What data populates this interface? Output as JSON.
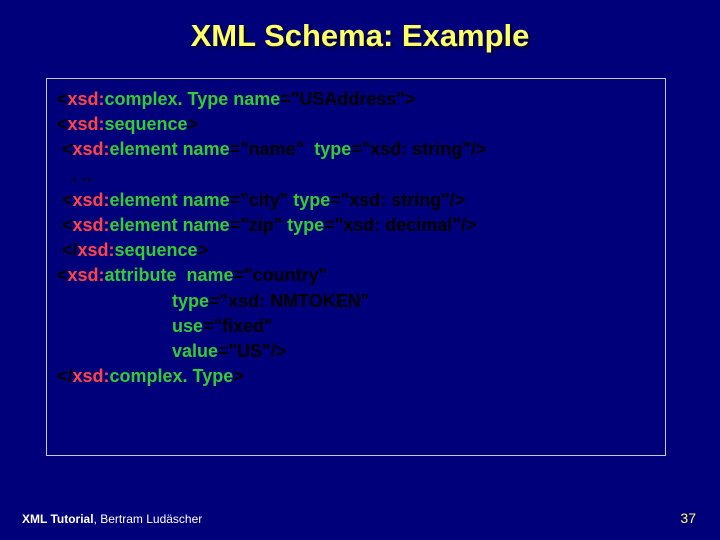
{
  "title": "XML Schema: Example",
  "footer": {
    "tutorial": "XML Tutorial",
    "author": ", Bertram Ludäscher",
    "page": "37"
  },
  "code": {
    "l1": {
      "open": "<",
      "ns": "xsd:",
      "kw": "complex. Type",
      "nameLbl": " name",
      "tail": "=\"USAddress\">"
    },
    "l2": {
      "open": "<",
      "ns": "xsd:",
      "kw": "sequence",
      "tail": ">"
    },
    "l3": {
      "ind": " ",
      "open": " <",
      "ns": "xsd:",
      "kw": "element",
      "nameLbl": " name",
      "eq1": "=\"name\"  ",
      "typeLbl": "type",
      "tail": "=\"xsd: string\"/>"
    },
    "l4": {
      "txt": "   . .."
    },
    "l5": {
      "ind": " ",
      "open": " <",
      "ns": "xsd:",
      "kw": "element",
      "nameLbl": " name",
      "eq1": "=\"city\" ",
      "typeLbl": "type",
      "tail": "=\"xsd: string\"/>"
    },
    "l6": {
      "ind": " ",
      "open": " <",
      "ns": "xsd:",
      "kw": "element",
      "nameLbl": " name",
      "eq1": "=\"zip\" ",
      "typeLbl": "type",
      "tail": "=\"xsd: decimal\"/>"
    },
    "l7": {
      "open": " </",
      "ns": "xsd:",
      "kw": "sequence",
      "tail": ">"
    },
    "l8": {
      "open": "<",
      "ns": "xsd:",
      "kw": "attribute",
      "nameLbl": "  name",
      "tail": "=\"country\""
    },
    "l9": {
      "pad": "                       ",
      "typeLbl": "type",
      "tail": "=\"xsd: NMTOKEN\""
    },
    "l10": {
      "pad": "                       ",
      "useLbl": "use",
      "tail": "=\"fixed\""
    },
    "l11": {
      "pad": "                       ",
      "valLbl": "value",
      "tail": "=\"US\"/>"
    },
    "l12": {
      "open": "</",
      "ns": "xsd:",
      "kw": "complex. Type",
      "tail": ">"
    }
  }
}
